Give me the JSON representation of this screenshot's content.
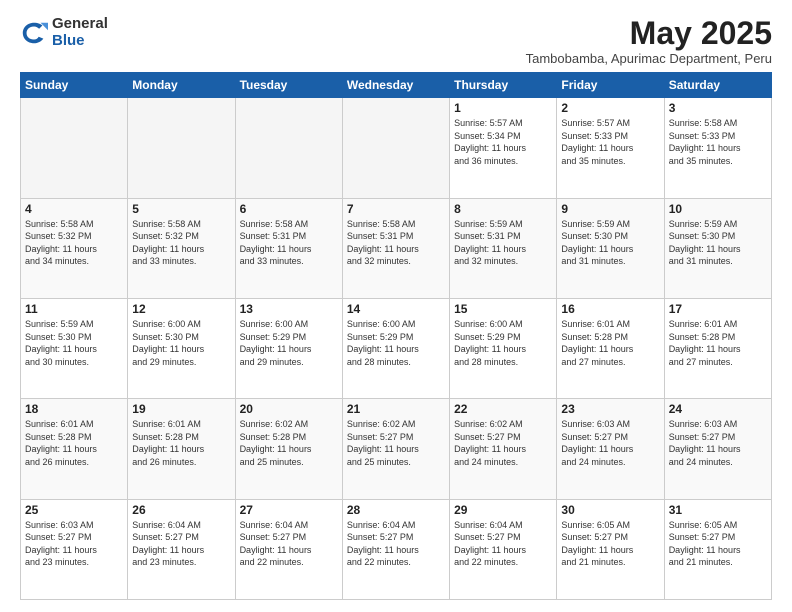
{
  "logo": {
    "general": "General",
    "blue": "Blue"
  },
  "header": {
    "month_year": "May 2025",
    "subtitle": "Tambobamba, Apurimac Department, Peru"
  },
  "weekdays": [
    "Sunday",
    "Monday",
    "Tuesday",
    "Wednesday",
    "Thursday",
    "Friday",
    "Saturday"
  ],
  "weeks": [
    [
      {
        "day": "",
        "info": "",
        "empty": true
      },
      {
        "day": "",
        "info": "",
        "empty": true
      },
      {
        "day": "",
        "info": "",
        "empty": true
      },
      {
        "day": "",
        "info": "",
        "empty": true
      },
      {
        "day": "1",
        "info": "Sunrise: 5:57 AM\nSunset: 5:34 PM\nDaylight: 11 hours\nand 36 minutes.",
        "empty": false
      },
      {
        "day": "2",
        "info": "Sunrise: 5:57 AM\nSunset: 5:33 PM\nDaylight: 11 hours\nand 35 minutes.",
        "empty": false
      },
      {
        "day": "3",
        "info": "Sunrise: 5:58 AM\nSunset: 5:33 PM\nDaylight: 11 hours\nand 35 minutes.",
        "empty": false
      }
    ],
    [
      {
        "day": "4",
        "info": "Sunrise: 5:58 AM\nSunset: 5:32 PM\nDaylight: 11 hours\nand 34 minutes.",
        "empty": false
      },
      {
        "day": "5",
        "info": "Sunrise: 5:58 AM\nSunset: 5:32 PM\nDaylight: 11 hours\nand 33 minutes.",
        "empty": false
      },
      {
        "day": "6",
        "info": "Sunrise: 5:58 AM\nSunset: 5:31 PM\nDaylight: 11 hours\nand 33 minutes.",
        "empty": false
      },
      {
        "day": "7",
        "info": "Sunrise: 5:58 AM\nSunset: 5:31 PM\nDaylight: 11 hours\nand 32 minutes.",
        "empty": false
      },
      {
        "day": "8",
        "info": "Sunrise: 5:59 AM\nSunset: 5:31 PM\nDaylight: 11 hours\nand 32 minutes.",
        "empty": false
      },
      {
        "day": "9",
        "info": "Sunrise: 5:59 AM\nSunset: 5:30 PM\nDaylight: 11 hours\nand 31 minutes.",
        "empty": false
      },
      {
        "day": "10",
        "info": "Sunrise: 5:59 AM\nSunset: 5:30 PM\nDaylight: 11 hours\nand 31 minutes.",
        "empty": false
      }
    ],
    [
      {
        "day": "11",
        "info": "Sunrise: 5:59 AM\nSunset: 5:30 PM\nDaylight: 11 hours\nand 30 minutes.",
        "empty": false
      },
      {
        "day": "12",
        "info": "Sunrise: 6:00 AM\nSunset: 5:30 PM\nDaylight: 11 hours\nand 29 minutes.",
        "empty": false
      },
      {
        "day": "13",
        "info": "Sunrise: 6:00 AM\nSunset: 5:29 PM\nDaylight: 11 hours\nand 29 minutes.",
        "empty": false
      },
      {
        "day": "14",
        "info": "Sunrise: 6:00 AM\nSunset: 5:29 PM\nDaylight: 11 hours\nand 28 minutes.",
        "empty": false
      },
      {
        "day": "15",
        "info": "Sunrise: 6:00 AM\nSunset: 5:29 PM\nDaylight: 11 hours\nand 28 minutes.",
        "empty": false
      },
      {
        "day": "16",
        "info": "Sunrise: 6:01 AM\nSunset: 5:28 PM\nDaylight: 11 hours\nand 27 minutes.",
        "empty": false
      },
      {
        "day": "17",
        "info": "Sunrise: 6:01 AM\nSunset: 5:28 PM\nDaylight: 11 hours\nand 27 minutes.",
        "empty": false
      }
    ],
    [
      {
        "day": "18",
        "info": "Sunrise: 6:01 AM\nSunset: 5:28 PM\nDaylight: 11 hours\nand 26 minutes.",
        "empty": false
      },
      {
        "day": "19",
        "info": "Sunrise: 6:01 AM\nSunset: 5:28 PM\nDaylight: 11 hours\nand 26 minutes.",
        "empty": false
      },
      {
        "day": "20",
        "info": "Sunrise: 6:02 AM\nSunset: 5:28 PM\nDaylight: 11 hours\nand 25 minutes.",
        "empty": false
      },
      {
        "day": "21",
        "info": "Sunrise: 6:02 AM\nSunset: 5:27 PM\nDaylight: 11 hours\nand 25 minutes.",
        "empty": false
      },
      {
        "day": "22",
        "info": "Sunrise: 6:02 AM\nSunset: 5:27 PM\nDaylight: 11 hours\nand 24 minutes.",
        "empty": false
      },
      {
        "day": "23",
        "info": "Sunrise: 6:03 AM\nSunset: 5:27 PM\nDaylight: 11 hours\nand 24 minutes.",
        "empty": false
      },
      {
        "day": "24",
        "info": "Sunrise: 6:03 AM\nSunset: 5:27 PM\nDaylight: 11 hours\nand 24 minutes.",
        "empty": false
      }
    ],
    [
      {
        "day": "25",
        "info": "Sunrise: 6:03 AM\nSunset: 5:27 PM\nDaylight: 11 hours\nand 23 minutes.",
        "empty": false
      },
      {
        "day": "26",
        "info": "Sunrise: 6:04 AM\nSunset: 5:27 PM\nDaylight: 11 hours\nand 23 minutes.",
        "empty": false
      },
      {
        "day": "27",
        "info": "Sunrise: 6:04 AM\nSunset: 5:27 PM\nDaylight: 11 hours\nand 22 minutes.",
        "empty": false
      },
      {
        "day": "28",
        "info": "Sunrise: 6:04 AM\nSunset: 5:27 PM\nDaylight: 11 hours\nand 22 minutes.",
        "empty": false
      },
      {
        "day": "29",
        "info": "Sunrise: 6:04 AM\nSunset: 5:27 PM\nDaylight: 11 hours\nand 22 minutes.",
        "empty": false
      },
      {
        "day": "30",
        "info": "Sunrise: 6:05 AM\nSunset: 5:27 PM\nDaylight: 11 hours\nand 21 minutes.",
        "empty": false
      },
      {
        "day": "31",
        "info": "Sunrise: 6:05 AM\nSunset: 5:27 PM\nDaylight: 11 hours\nand 21 minutes.",
        "empty": false
      }
    ]
  ]
}
